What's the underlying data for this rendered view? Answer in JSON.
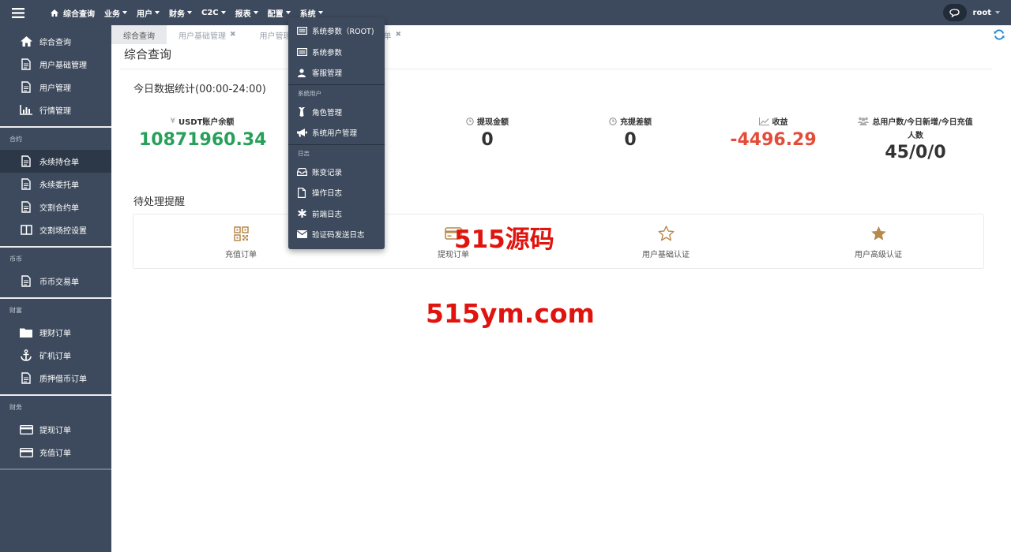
{
  "topbar": {
    "home_label": "综合查询",
    "menus": [
      "业务",
      "用户",
      "财务",
      "C2C",
      "报表",
      "配置",
      "系统"
    ],
    "username": "root"
  },
  "sidebar": {
    "top_items": [
      {
        "label": "综合查询",
        "icon": "home-icon"
      },
      {
        "label": "用户基础管理",
        "icon": "document-icon"
      },
      {
        "label": "用户管理",
        "icon": "document-icon"
      },
      {
        "label": "行情管理",
        "icon": "bar-chart-icon"
      }
    ],
    "groups": [
      {
        "title": "合约",
        "items": [
          {
            "label": "永续持仓单",
            "icon": "document-icon"
          },
          {
            "label": "永续委托单",
            "icon": "document-icon"
          },
          {
            "label": "交割合约单",
            "icon": "document-icon"
          },
          {
            "label": "交割场控设置",
            "icon": "book-icon"
          }
        ]
      },
      {
        "title": "币币",
        "items": [
          {
            "label": "币币交易单",
            "icon": "document-icon"
          }
        ]
      },
      {
        "title": "财富",
        "items": [
          {
            "label": "理财订单",
            "icon": "folder-icon"
          },
          {
            "label": "矿机订单",
            "icon": "anchor-icon"
          },
          {
            "label": "质押借币订单",
            "icon": "document-icon"
          }
        ]
      },
      {
        "title": "财务",
        "items": [
          {
            "label": "提现订单",
            "icon": "credit-card-icon"
          },
          {
            "label": "充值订单",
            "icon": "credit-card-icon"
          }
        ]
      }
    ]
  },
  "tabs": [
    {
      "label": "综合查询",
      "closable": false
    },
    {
      "label": "用户基础管理",
      "closable": true
    },
    {
      "label": "用户管理",
      "closable": false
    },
    {
      "label": "永续持仓单",
      "closable": true
    }
  ],
  "page_title": "综合查询",
  "stats_title": "今日数据统计(00:00-24:00)",
  "stats": {
    "usdt": {
      "prefix": "¥",
      "label": "USDT账户余额",
      "value": "10871960.34",
      "color": "#27a05a"
    },
    "withdraw": {
      "label": "提现金额",
      "value": "0",
      "color": "#333333"
    },
    "diff": {
      "label": "充提差额",
      "value": "0",
      "color": "#333333"
    },
    "income": {
      "label": "收益",
      "value": "-4496.29",
      "color": "#e44c3a"
    },
    "users": {
      "label": "总用户数/今日新增/今日充值",
      "label2": "人数",
      "value": "45/0/0",
      "color": "#333333"
    }
  },
  "pending_title": "待处理提醒",
  "pending": [
    {
      "label": "充值订单",
      "icon": "qrcode-icon"
    },
    {
      "label": "提现订单",
      "icon": "credit-card-icon"
    },
    {
      "label": "用户基础认证",
      "icon": "star-outline-icon"
    },
    {
      "label": "用户高级认证",
      "icon": "star-icon"
    }
  ],
  "accent_gold": "#b7894b",
  "watermark": {
    "line1": "515源码",
    "line2": "515ym.com"
  },
  "dropdown": {
    "items1": [
      {
        "label": "系统参数（ROOT)",
        "icon": "list-icon"
      },
      {
        "label": "系统参数",
        "icon": "list-icon"
      },
      {
        "label": "客服管理",
        "icon": "user-icon"
      }
    ],
    "group2": "系统用户",
    "items2": [
      {
        "label": "角色管理",
        "icon": "tie-icon"
      },
      {
        "label": "系统用户管理",
        "icon": "bullhorn-icon"
      }
    ],
    "group3": "日志",
    "items3": [
      {
        "label": "账变记录",
        "icon": "inbox-icon"
      },
      {
        "label": "操作日志",
        "icon": "file-icon"
      },
      {
        "label": "前端日志",
        "icon": "asterisk-icon"
      },
      {
        "label": "验证码发送日志",
        "icon": "envelope-icon"
      }
    ]
  }
}
